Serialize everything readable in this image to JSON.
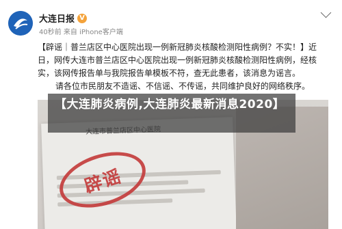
{
  "header": {
    "account_name": "大连日报",
    "verified_badge": "V",
    "meta": "40秒前 来自 iPhone客户端"
  },
  "post": {
    "line1": "【辟谣｜普兰店区中心医院出现一例新冠肺炎核酸检测阳性病例？不实！】近",
    "line2": "日，网传大连市普兰店区中心医院出现一例新冠肺炎核酸检测阳性病例，经核",
    "line3": "实，该网传报告单与我院报告单模板不符，查无此患者，该消息为谣言。",
    "line4": "请各位市民朋友不造谣、不信谣、不传谣，共同维护良好的网络秩序。"
  },
  "image": {
    "stamp_text": "辟谣",
    "paper_title": "大连市普兰店区中心医院"
  },
  "overlay": {
    "caption": "【大连肺炎病例,大连肺炎最新消息2020】"
  }
}
